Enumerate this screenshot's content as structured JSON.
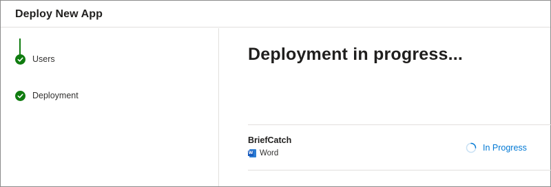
{
  "window": {
    "title": "Deploy New App"
  },
  "steps": [
    {
      "label": "Users",
      "state": "complete",
      "icon": "checkmark-circle-icon"
    },
    {
      "label": "Deployment",
      "state": "complete",
      "icon": "checkmark-circle-icon"
    }
  ],
  "main": {
    "title": "Deployment in progress...",
    "apps": [
      {
        "name": "BriefCatch",
        "type_label": "Word",
        "type_icon": "word-icon",
        "status_label": "In Progress",
        "status_icon": "spinner-icon"
      }
    ]
  },
  "colors": {
    "step_complete": "#107c10",
    "status_text": "#0078d4",
    "word_icon": "#2b7cd3"
  }
}
